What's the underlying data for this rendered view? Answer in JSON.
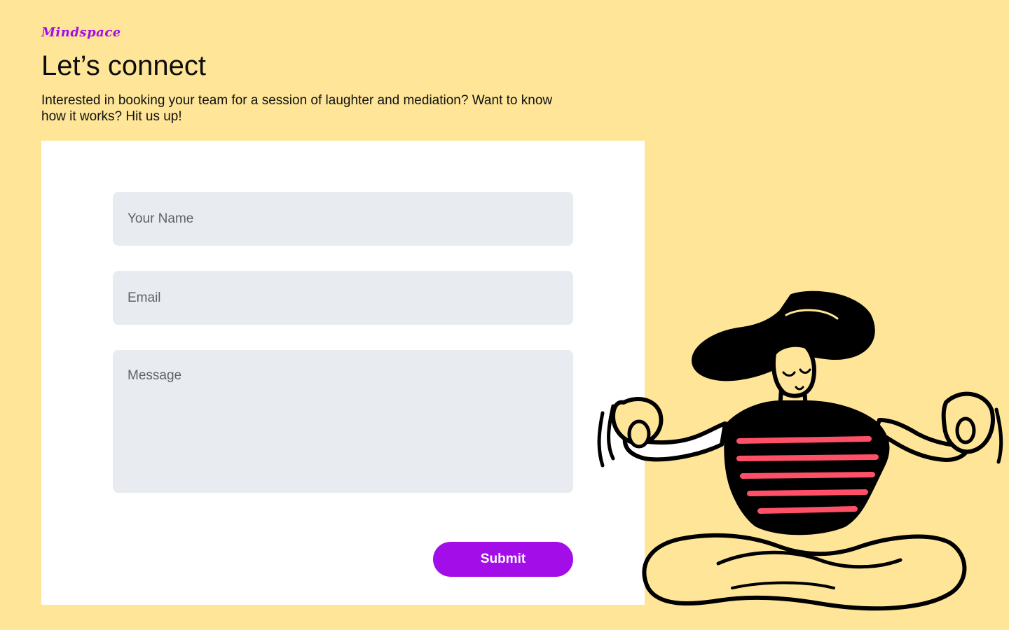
{
  "brand": {
    "name": "Mindspace",
    "color": "#a30ee8"
  },
  "header": {
    "title": "Let’s connect",
    "intro": "Interested in booking your team for a session of laughter and mediation? Want to know how it works? Hit us up!"
  },
  "form": {
    "name_placeholder": "Your Name",
    "email_placeholder": "Email",
    "message_placeholder": "Message",
    "submit_label": "Submit"
  },
  "illustration": {
    "icon": "meditating-person-illustration"
  },
  "colors": {
    "background": "#fee598",
    "accent": "#a30ee8",
    "field": "#e8ebef",
    "stripe": "#ff5068"
  }
}
